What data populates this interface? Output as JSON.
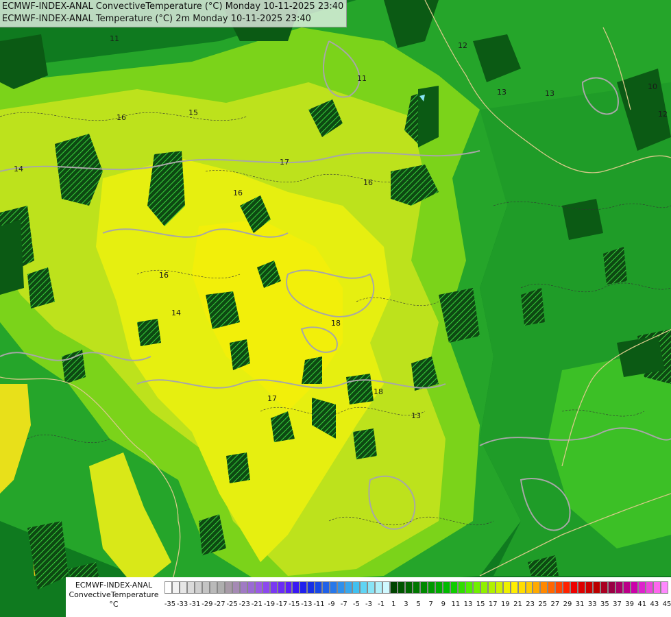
{
  "header": {
    "line1": "ECMWF-INDEX-ANAL ConvectiveTemperature (°C) Monday 10-11-2025 23:40",
    "line2": "ECMWF-INDEX-ANAL Temperature (°C) 2m Monday 10-11-2025 23:40"
  },
  "legend": {
    "line1": "ECMWF-INDEX-ANAL",
    "line2": "ConvectiveTemperature",
    "line3": "°C",
    "ticks": [
      "-35",
      "-33",
      "-31",
      "-29",
      "-27",
      "-25",
      "-23",
      "-21",
      "-19",
      "-17",
      "-15",
      "-13",
      "-11",
      "-9",
      "-7",
      "-5",
      "-3",
      "-1",
      "1",
      "3",
      "5",
      "7",
      "9",
      "11",
      "13",
      "15",
      "17",
      "19",
      "21",
      "23",
      "25",
      "27",
      "29",
      "31",
      "33",
      "35",
      "37",
      "39",
      "41",
      "43",
      "45"
    ],
    "colors": [
      "#ffffff",
      "#f2f2f2",
      "#e6e6e6",
      "#dadada",
      "#cfcfcf",
      "#c4c4c4",
      "#b9b9b9",
      "#aeaeae",
      "#a79aa7",
      "#a58ab4",
      "#a07ac4",
      "#9a6ad4",
      "#9a5ae4",
      "#8c48ee",
      "#7a38f2",
      "#6a2cf6",
      "#5a20fa",
      "#3a18f4",
      "#2020ee",
      "#1830e6",
      "#1848e6",
      "#2060e8",
      "#2878ea",
      "#3090ec",
      "#38a8ee",
      "#40c0f0",
      "#60d4f4",
      "#88e4f6",
      "#b0f0fa",
      "#cff8ff",
      "#004400",
      "#005500",
      "#006600",
      "#007700",
      "#008800",
      "#009900",
      "#00aa00",
      "#00bb00",
      "#10cc00",
      "#30dd00",
      "#50ee00",
      "#70f000",
      "#90f000",
      "#b0f000",
      "#d0f000",
      "#eef000",
      "#ffee00",
      "#ffdd00",
      "#ffcc00",
      "#ffaa00",
      "#ff8800",
      "#ff6600",
      "#ff4400",
      "#ff2200",
      "#ee0000",
      "#dd0000",
      "#cc0000",
      "#bb0000",
      "#aa0022",
      "#990044",
      "#aa0066",
      "#bb0088",
      "#cc00aa",
      "#dd22cc",
      "#ee44dd",
      "#ff66ee",
      "#ff88ff"
    ]
  },
  "map": {
    "contour_labels": [
      "11",
      "12",
      "13",
      "14",
      "15",
      "16",
      "17",
      "18",
      "10",
      "12",
      "13",
      "14",
      "16",
      "16",
      "16",
      "17",
      "18",
      "11",
      "13"
    ]
  }
}
